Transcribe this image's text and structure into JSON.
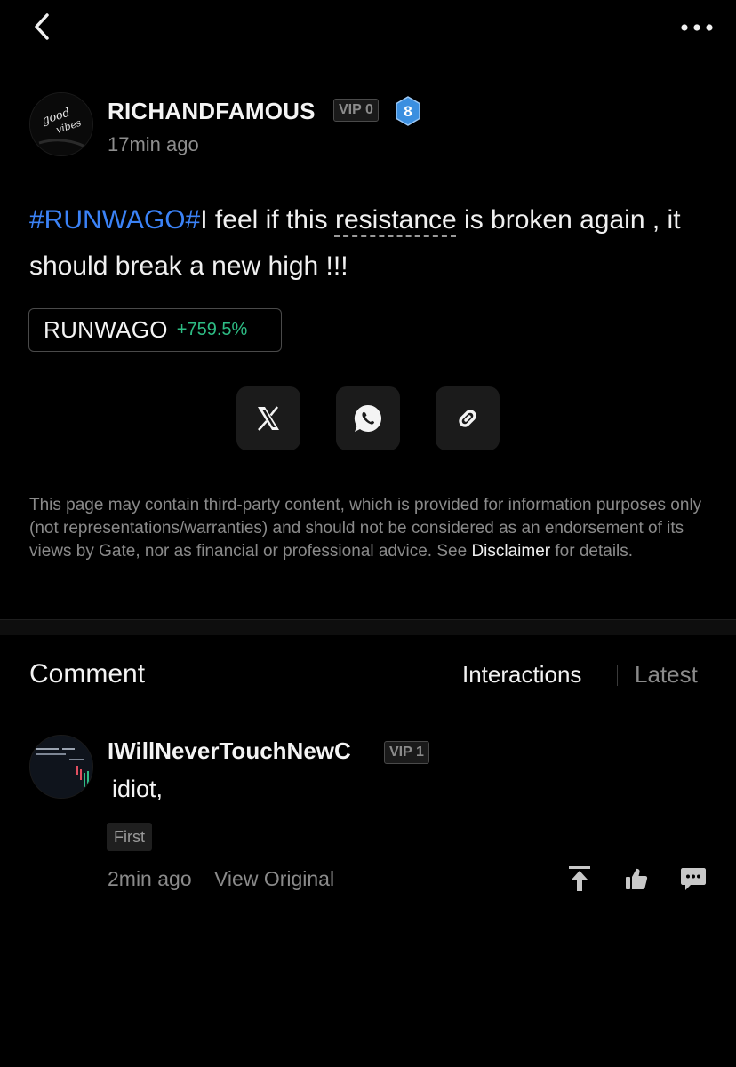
{
  "header": {
    "back_icon": "chevron-left-icon",
    "more_icon": "more-dots-icon"
  },
  "author": {
    "name": "RICHANDFAMOUS",
    "vip": "VIP 0",
    "level": "8",
    "time": "17min ago",
    "avatar_text": "good vibes"
  },
  "post": {
    "hashtag": "#RUNWAGO#",
    "text_before": "I feel if this ",
    "highlighted": "resistance",
    "text_after": " is broken again , it should break a new high !!!"
  },
  "coin": {
    "name": "RUNWAGO",
    "change": "+759.5%"
  },
  "share": {
    "icons": [
      "x-icon",
      "whatsapp-icon",
      "link-icon"
    ]
  },
  "disclaimer": {
    "text": "This page may contain third-party content, which is provided for information purposes only (not representations/warranties) and should not be considered as an endorsement of its views by Gate, nor as financial or professional advice. See ",
    "link": "Disclaimer",
    "suffix": " for details."
  },
  "comments_section": {
    "title": "Comment",
    "tabs": [
      "Interactions",
      "Latest"
    ],
    "active_tab": "Interactions"
  },
  "comments": [
    {
      "user": "IWillNeverTouchNewC",
      "vip": "VIP 1",
      "text": "idiot,",
      "tag": "First",
      "time": "2min ago",
      "view_original": "View Original"
    }
  ],
  "colors": {
    "background": "#000000",
    "hashtag": "#3b82f6",
    "positive": "#2ebd85",
    "level_badge": "#3b8fe0"
  }
}
